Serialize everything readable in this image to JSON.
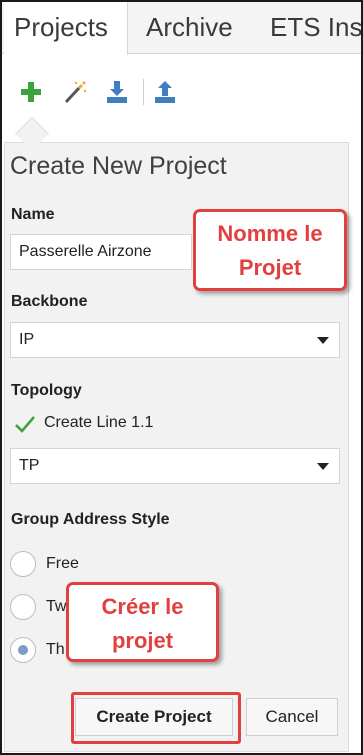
{
  "tabs": [
    {
      "label": "Projects",
      "active": true
    },
    {
      "label": "Archive",
      "active": false
    },
    {
      "label": "ETS Insi",
      "active": false
    }
  ],
  "toolbar": {
    "icons": [
      "add-icon",
      "magic-wand-icon",
      "import-icon",
      "export-icon"
    ],
    "accent_green": "#3aa33a",
    "accent_blue": "#3f7fbf"
  },
  "panel": {
    "title": "Create New Project",
    "name_label": "Name",
    "name_value": "Passerelle Airzone",
    "backbone_label": "Backbone",
    "backbone_value": "IP",
    "topology_label": "Topology",
    "create_line_label": "Create Line 1.1",
    "create_line_checked": true,
    "topology_value": "TP",
    "group_address_label": "Group Address Style",
    "radio_options": [
      {
        "label": "Free",
        "selected": false
      },
      {
        "label": "Tw",
        "selected": false
      },
      {
        "label": "Th",
        "selected": true
      }
    ]
  },
  "buttons": {
    "create_label": "Create Project",
    "cancel_label": "Cancel"
  },
  "annotations": {
    "name_callout": [
      "Nomme le",
      "Projet"
    ],
    "create_callout": [
      "Créer le",
      "projet"
    ],
    "color": "#e2403f"
  }
}
